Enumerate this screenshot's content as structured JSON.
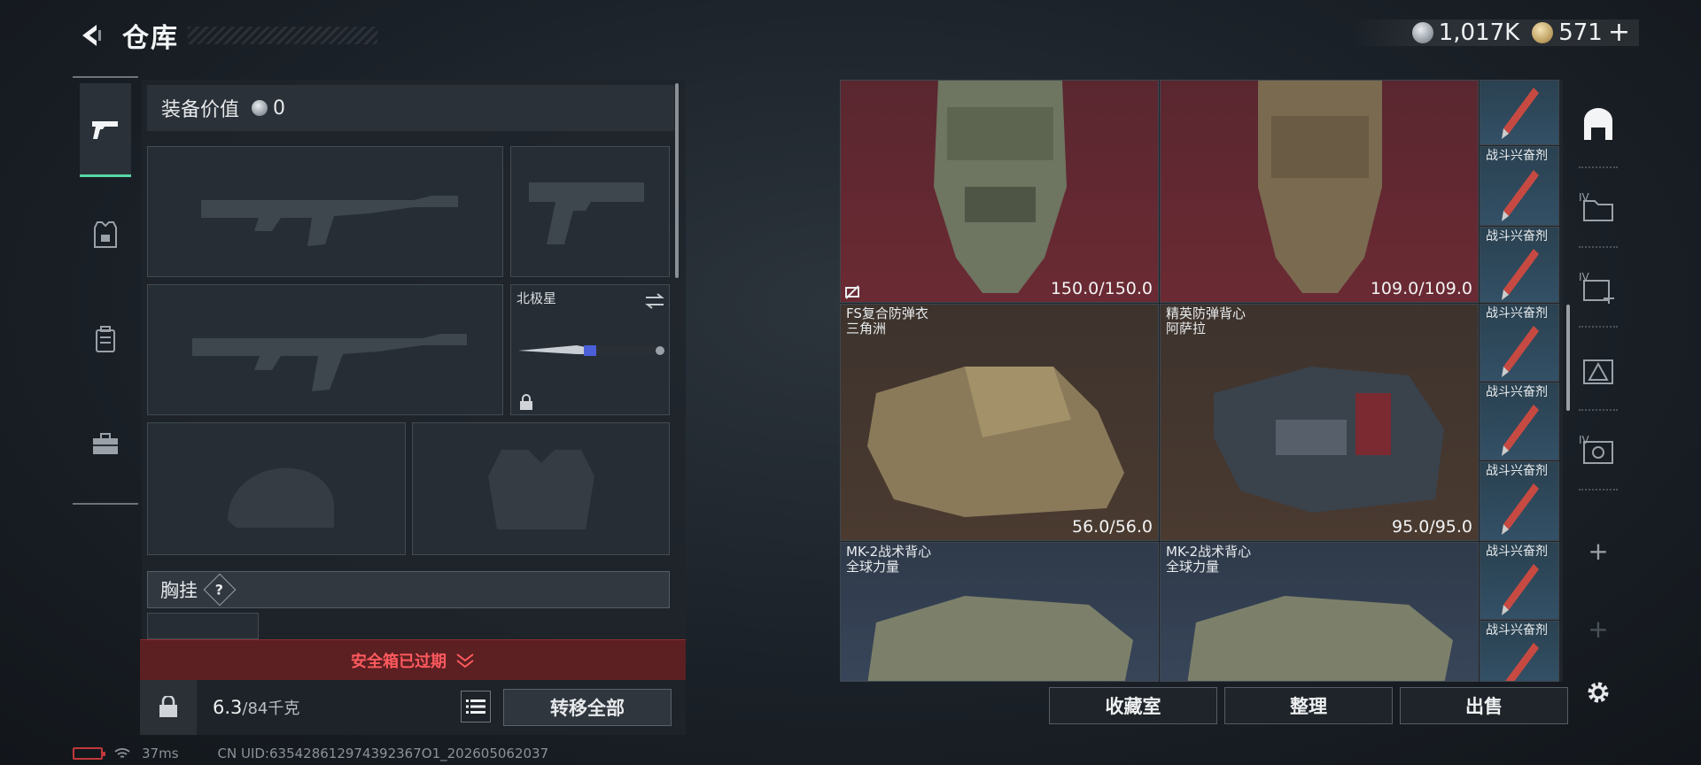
{
  "header": {
    "title": "仓库"
  },
  "currency": {
    "silver": "1,017K",
    "gold": "571"
  },
  "equipment": {
    "value_label": "装备价值",
    "value": "0",
    "knife_name": "北极星",
    "chest_label": "胸挂",
    "help_mark": "?",
    "secure_case_status": "安全箱已过期",
    "weight_current": "6.3",
    "weight_max": "/84千克",
    "transfer_all": "转移全部"
  },
  "items": [
    {
      "name_line1": "",
      "name_line2": "",
      "durability": "150.0/150.0",
      "color": "red"
    },
    {
      "name_line1": "",
      "name_line2": "",
      "durability": "109.0/109.0",
      "color": "red"
    },
    {
      "name_line1": "FS复合防弹衣",
      "name_line2": "三角洲",
      "durability": "56.0/56.0",
      "color": "brown"
    },
    {
      "name_line1": "精英防弹背心",
      "name_line2": "阿萨拉",
      "durability": "95.0/95.0",
      "color": "brown"
    },
    {
      "name_line1": "MK-2战术背心",
      "name_line2": "全球力量",
      "durability": "",
      "color": "blue"
    },
    {
      "name_line1": "MK-2战术背心",
      "name_line2": "全球力量",
      "durability": "",
      "color": "blue"
    }
  ],
  "stims": [
    "",
    "战斗兴奋剂",
    "战斗兴奋剂",
    "战斗兴奋剂",
    "战斗兴奋剂",
    "战斗兴奋剂",
    "战斗兴奋剂",
    "战斗兴奋剂"
  ],
  "actions": {
    "collection": "收藏室",
    "sort": "整理",
    "sell": "出售"
  },
  "right_rail_labels": {
    "tab2": "IV",
    "tab3": "IV",
    "tab5": "IV"
  },
  "status": {
    "ping": "37ms",
    "uid": "CN UID:635428612974392367O1_202605062037"
  },
  "colors": {
    "accent": "#56d6a6",
    "alert": "#ff5a5e",
    "rare_red": "#6b2a33",
    "epic_brown": "#4a3a30",
    "rare_blue": "#384559"
  }
}
